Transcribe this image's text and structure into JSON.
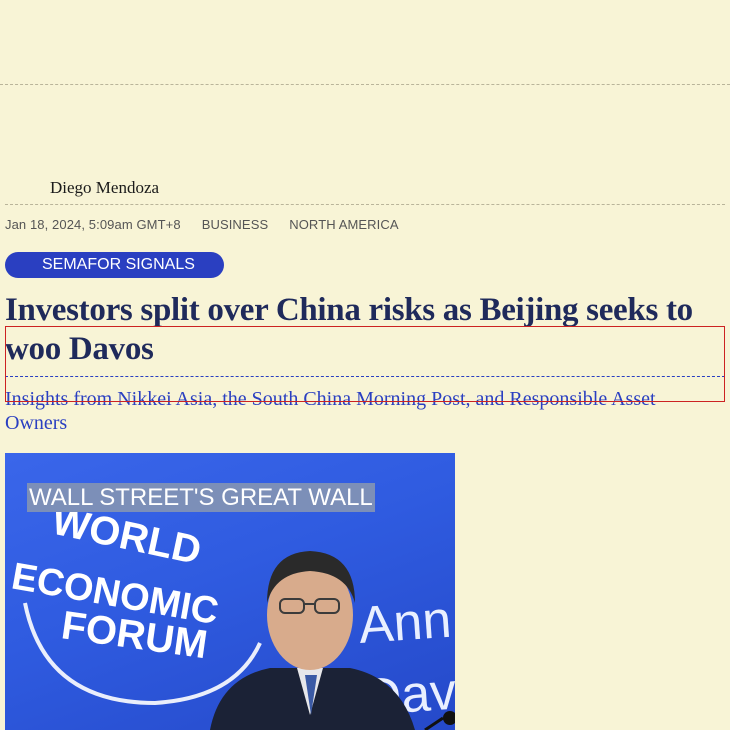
{
  "article": {
    "author": "Diego Mendoza",
    "timestamp": "Jan 18, 2024, 5:09am GMT+8",
    "categories": [
      "BUSINESS",
      "NORTH AMERICA"
    ],
    "badge": "SEMAFOR SIGNALS",
    "headline": "Investors split over China risks as Beijing seeks to woo Davos",
    "dek": "Insights from Nikkei Asia, the South China Morning Post, and Responsible Asset Owners"
  },
  "hero": {
    "caption": "WALL STREET'S GREAT WALL",
    "backdrop_logo_text": [
      "WORLD",
      "ECONOMIC",
      "FORUM"
    ],
    "backdrop_side_text": [
      "Ann",
      "Dav"
    ]
  },
  "colors": {
    "page_background": "#f8f4d6",
    "accent_blue": "#2a3fc1",
    "headline_navy": "#1f2a5b",
    "highlight_red": "#cc2222"
  }
}
